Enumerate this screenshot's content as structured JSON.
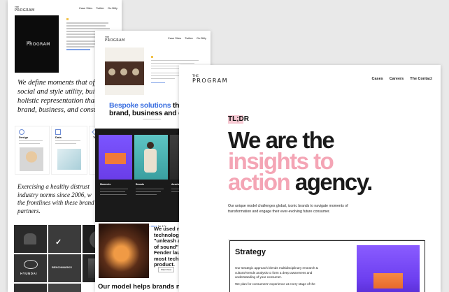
{
  "sheet1": {
    "logo_top": "THE",
    "logo_main": "PROGRAM",
    "nav": [
      "Case Sites",
      "Twitter",
      "Go Bitly"
    ],
    "hero_logo_top": "THE",
    "hero_logo_main": "PROGRAM",
    "define_lines": [
      "We define moments that off",
      "social and style utility, build",
      "holistic representation that",
      "brand, business, and consu"
    ],
    "card_titles": [
      "Design",
      "Data",
      "Trends"
    ],
    "exercise_lines": [
      "Exercising a healthy distrust",
      "industry norms since 2006, w",
      "the frontlines with these brand",
      "partners."
    ],
    "tile_labels": [
      "HYUNDAI",
      "BENCHMARKS"
    ]
  },
  "sheet2": {
    "logo_top": "THE",
    "logo_main": "PROGRAM",
    "nav": [
      "Case Sites",
      "Twitter",
      "Go Bitly"
    ],
    "bespoke_blue": "Bespoke solutions",
    "bespoke_rest": " that se",
    "bespoke_line2": "brand, business and consu",
    "label_cols": [
      "Moments",
      "Brands",
      "Assets"
    ],
    "caption_lead": "We've been",
    "caption_link": "redefining for the industry ever since",
    "caption_tail": "for 17y",
    "we_used_lines": [
      "We used n",
      "technolog",
      "\"unleash a",
      "of sound\"",
      "Fender lau",
      "most techn",
      "product."
    ],
    "watch_button": "Watch Now",
    "model_line": "Our model helps brands navig"
  },
  "sheet3": {
    "logo_top": "THE",
    "logo_main": "PROGRAM",
    "nav": [
      "Cases",
      "Careers",
      "The Contact"
    ],
    "tldr": "TL;DR",
    "headline_dark1": "We are the",
    "headline_pink1": "insights to",
    "headline_pink2": "action",
    "headline_dark2": " agency.",
    "intro": "Our unique model challenges global, iconic brands to navigate moments of transformation and engage their ever-evolving future consumer.",
    "strategy_title": "Strategy",
    "strategy_p1": "Our strategic approach blends multidisciplinary research & cultural-trends analysis to form a deep awareness and understanding of your consumer.",
    "strategy_p2": "We plan for consumers' experience at every stage of the"
  },
  "colors": {
    "pink": "#f4a5b5",
    "blue": "#3b6fe0",
    "purple": "#7a4cff",
    "orange": "#f07a3a"
  }
}
